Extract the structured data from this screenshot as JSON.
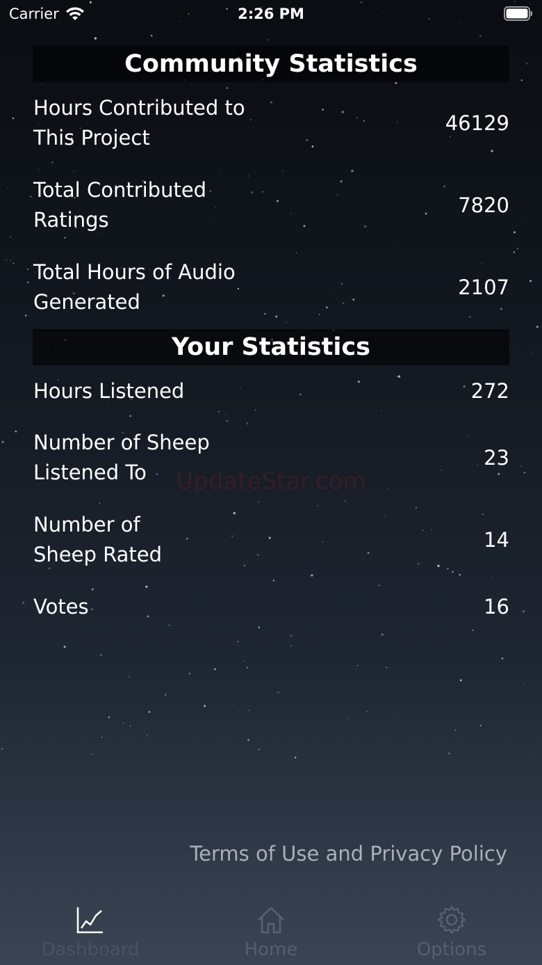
{
  "status_bar": {
    "carrier": "Carrier",
    "time": "2:26 PM"
  },
  "community": {
    "title": "Community Statistics",
    "rows": [
      {
        "label": "Hours Contributed to This Project",
        "value": "46129"
      },
      {
        "label": "Total Contributed Ratings",
        "value": "7820"
      },
      {
        "label": "Total Hours of Audio Generated",
        "value": "2107"
      }
    ]
  },
  "personal": {
    "title": "Your Statistics",
    "rows": [
      {
        "label": "Hours Listened",
        "value": "272"
      },
      {
        "label": "Number of Sheep Listened To",
        "value": "23"
      },
      {
        "label": "Number of Sheep Rated",
        "value": "14"
      },
      {
        "label": "Votes",
        "value": "16"
      }
    ]
  },
  "watermark": "UpdateStar.com",
  "footer": {
    "terms_link": "Terms of Use and Privacy Policy"
  },
  "tabs": [
    {
      "label": "Dashboard",
      "icon": "chart-line-icon",
      "active": true
    },
    {
      "label": "Home",
      "icon": "home-icon",
      "active": false
    },
    {
      "label": "Options",
      "icon": "gear-icon",
      "active": false
    }
  ]
}
